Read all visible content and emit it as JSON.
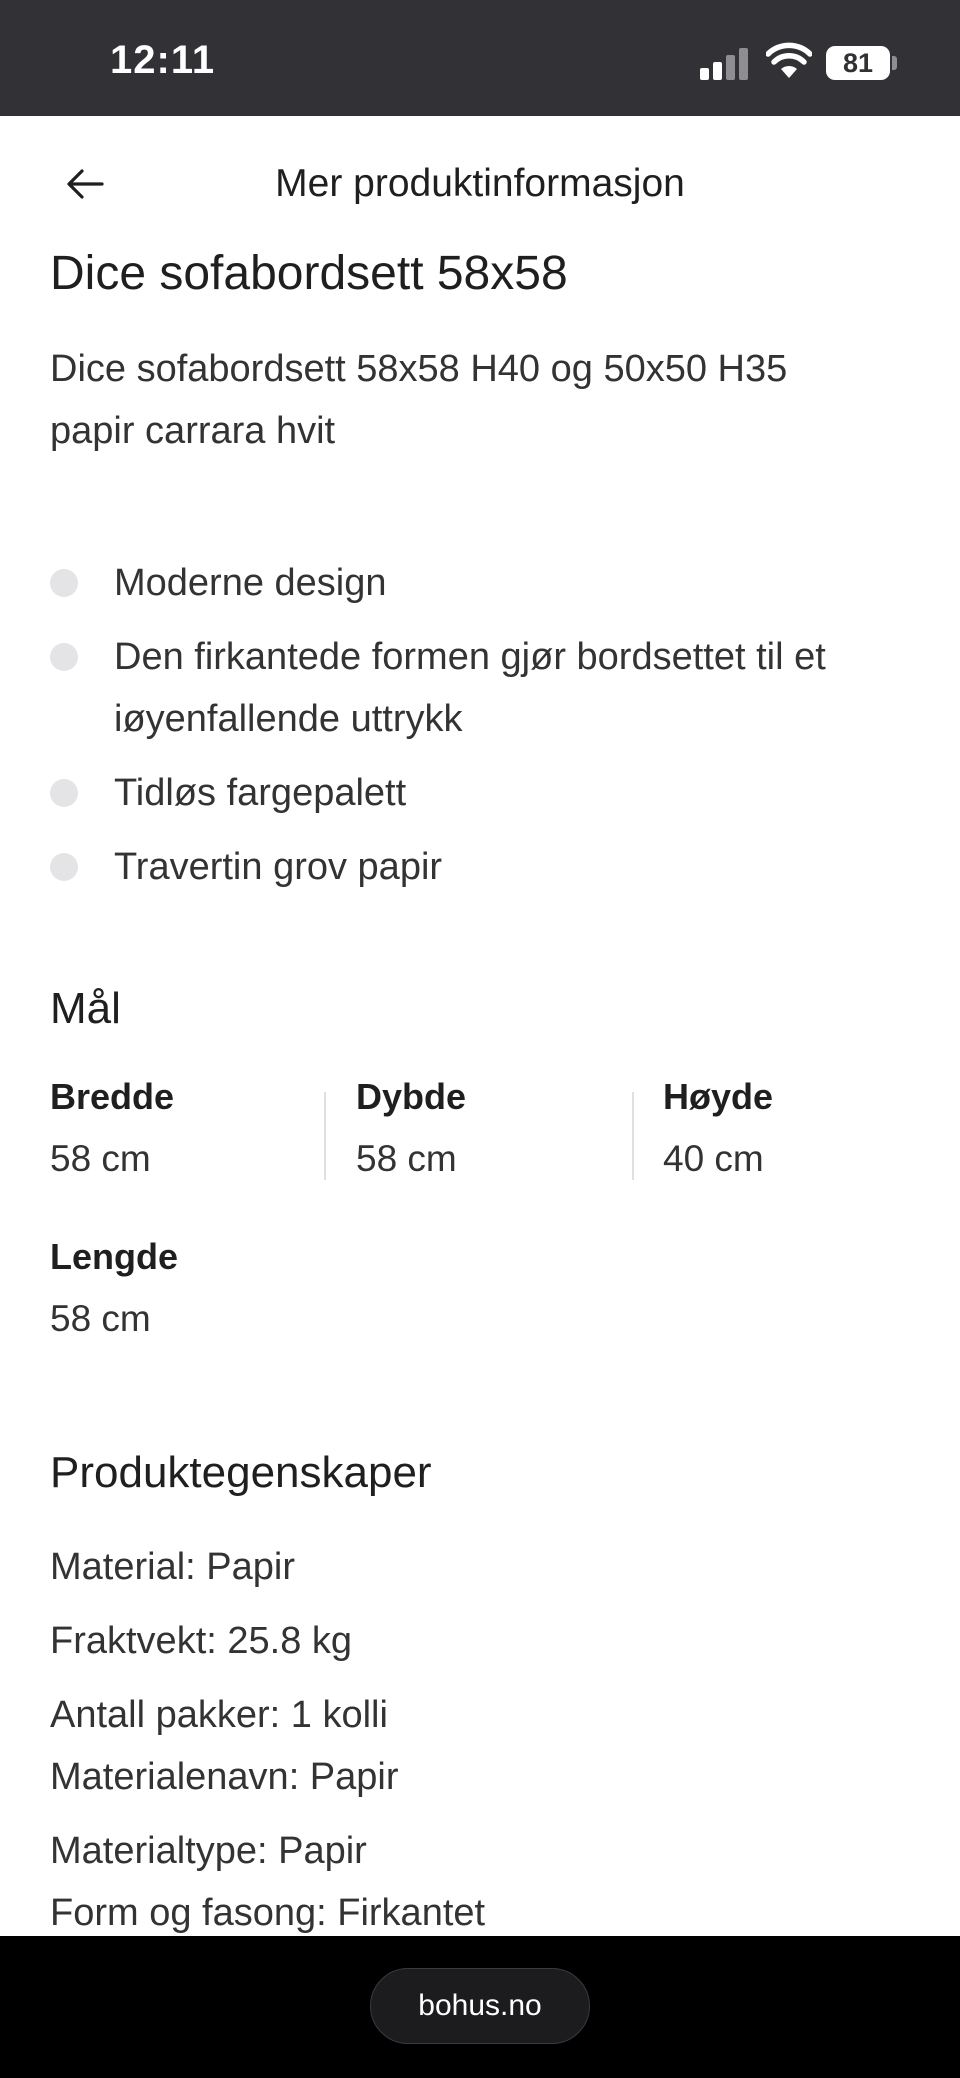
{
  "status_bar": {
    "time": "12:11",
    "battery": "81"
  },
  "header": {
    "title": "Mer produktinformasjon"
  },
  "product": {
    "title": "Dice sofabordsett 58x58",
    "description": "Dice sofabordsett 58x58 H40 og 50x50 H35 papir carrara hvit",
    "features": [
      "Moderne design",
      "Den firkantede formen gjør bordsettet til et iøyenfallende uttrykk",
      "Tidløs fargepalett",
      "Travertin grov papir"
    ]
  },
  "dimensions": {
    "title": "Mål",
    "items": [
      {
        "label": "Bredde",
        "value": "58 cm"
      },
      {
        "label": "Dybde",
        "value": "58 cm"
      },
      {
        "label": "Høyde",
        "value": "40 cm"
      },
      {
        "label": "Lengde",
        "value": "58 cm"
      }
    ]
  },
  "properties": {
    "title": "Produktegenskaper",
    "lines": [
      "Material: Papir",
      "Fraktvekt: 25.8 kg",
      "Antall pakker: 1 kolli",
      "Materialenavn: Papir",
      "Materialtype: Papir",
      "Form og fasong: Firkantet"
    ]
  },
  "browser": {
    "url": "bohus.no"
  }
}
